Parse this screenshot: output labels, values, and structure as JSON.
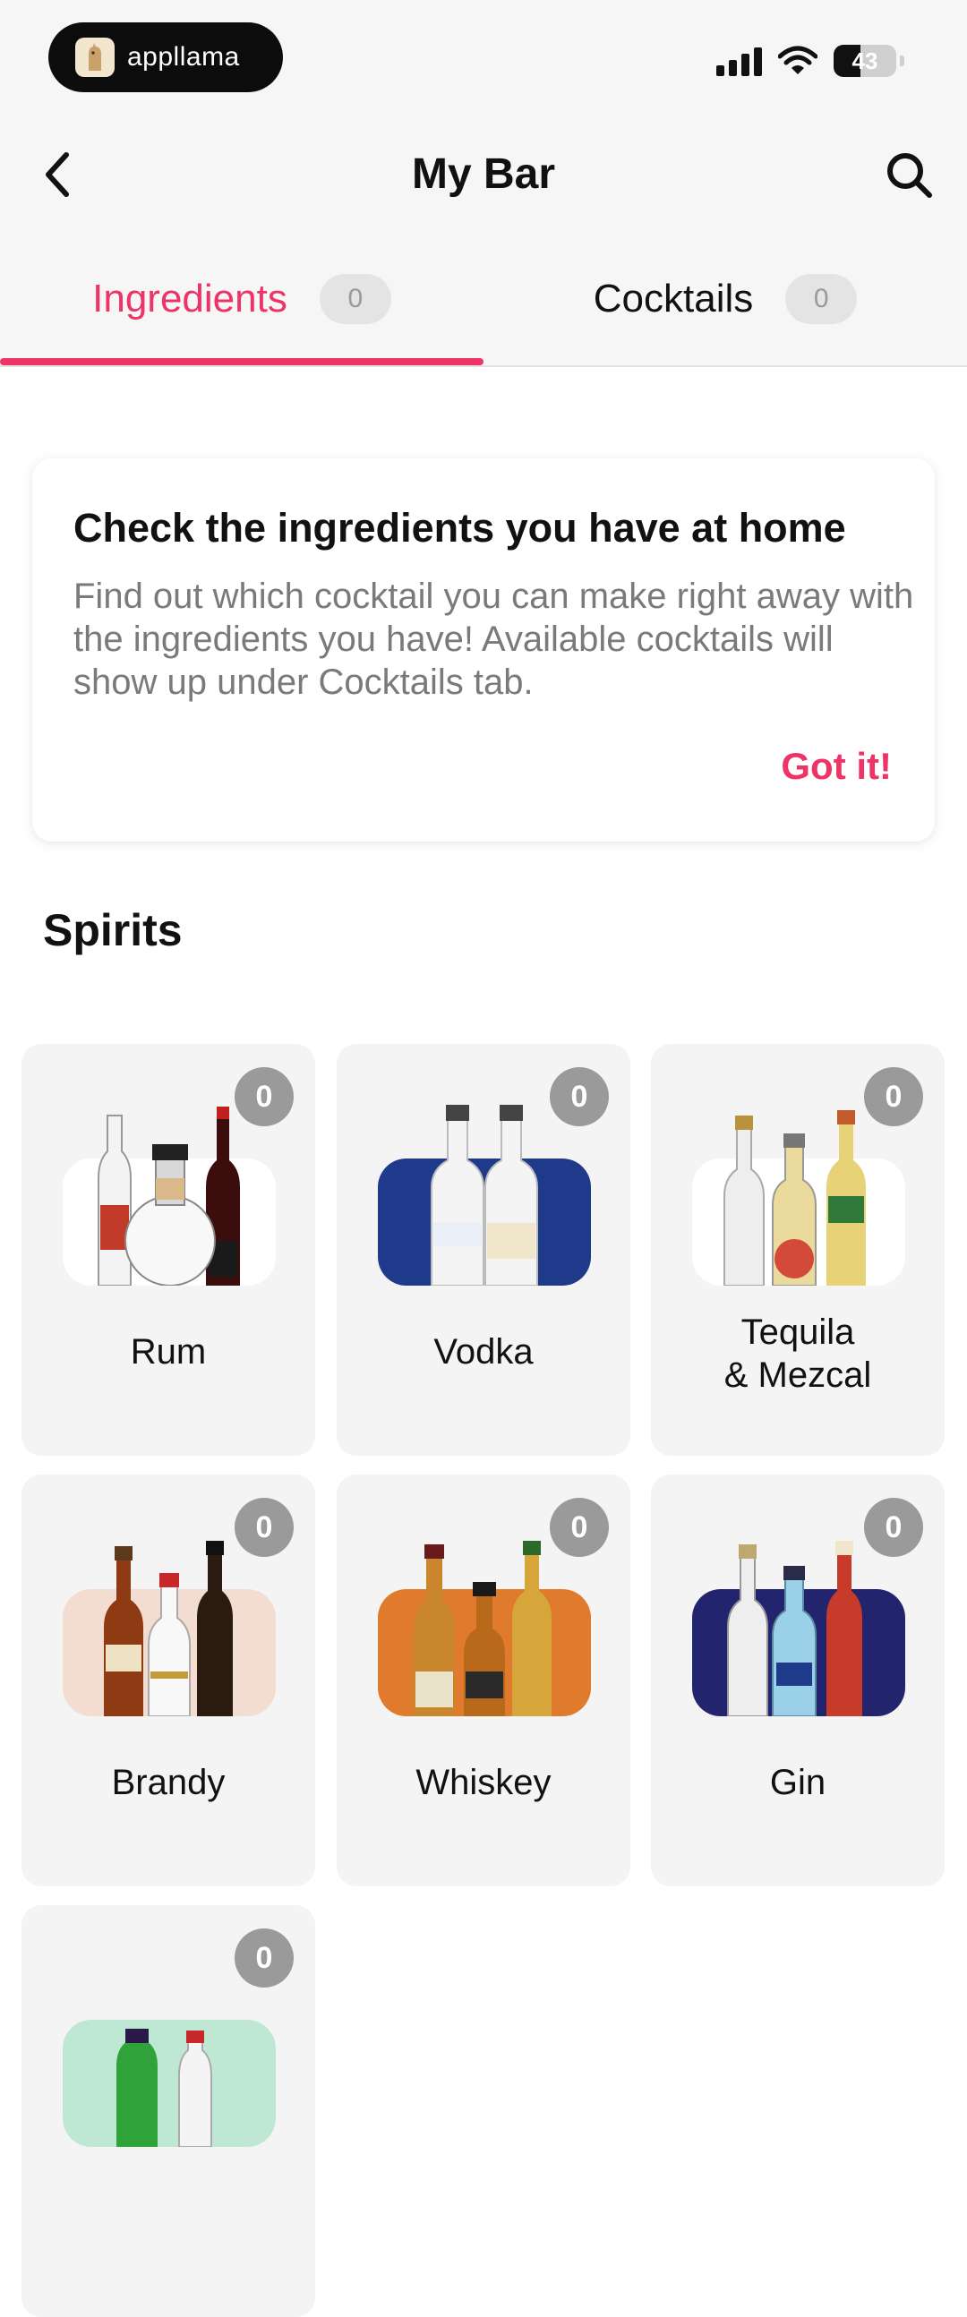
{
  "status_bar": {
    "brand": "appllama",
    "battery": "43",
    "battery_level": 0.43
  },
  "nav": {
    "title": "My Bar"
  },
  "tabs": [
    {
      "label": "Ingredients",
      "count": "0",
      "active": true
    },
    {
      "label": "Cocktails",
      "count": "0",
      "active": false
    }
  ],
  "info_card": {
    "heading": "Check the ingredients you have at home",
    "body": "Find out which cocktail you can make right away with the ingredients you have! Available cocktails will show up under Cocktails tab.",
    "action": "Got it!"
  },
  "section_title": "Spirits",
  "spirits": [
    {
      "name": "Rum",
      "count": "0",
      "tile_color": "#ffffff",
      "icon": "rum-bottles-icon"
    },
    {
      "name": "Vodka",
      "count": "0",
      "tile_color": "#1f3a8a",
      "icon": "vodka-bottles-icon"
    },
    {
      "name": "Tequila\n& Mezcal",
      "count": "0",
      "tile_color": "#ffffff",
      "icon": "tequila-bottles-icon"
    },
    {
      "name": "Brandy",
      "count": "0",
      "tile_color": "#f2ddd0",
      "icon": "brandy-bottles-icon"
    },
    {
      "name": "Whiskey",
      "count": "0",
      "tile_color": "#e07a2c",
      "icon": "whiskey-bottles-icon"
    },
    {
      "name": "Gin",
      "count": "0",
      "tile_color": "#23246e",
      "icon": "gin-bottles-icon"
    },
    {
      "name": "",
      "count": "0",
      "tile_color": "#bfe8d4",
      "icon": "liqueur-bottles-icon"
    }
  ],
  "accent_color": "#ee3366"
}
